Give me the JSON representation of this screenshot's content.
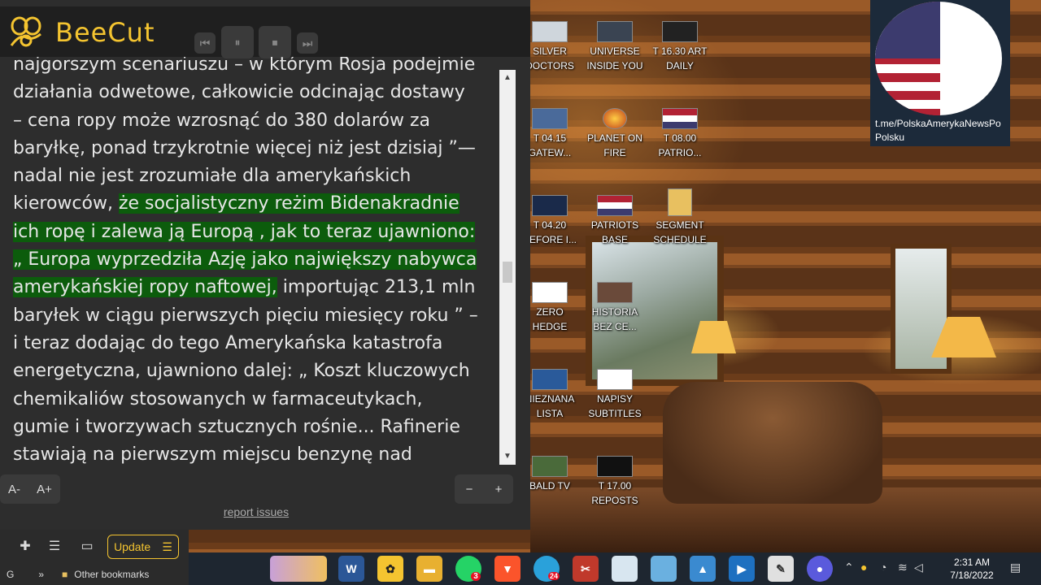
{
  "reader": {
    "app_name": "BeeCut",
    "controls": {
      "prev": "⏮",
      "pause": "⏸",
      "stop": "⏹",
      "next": "⏭"
    },
    "text": {
      "line0": "najgorszym scenariuszu – w którym Rosja podejmie",
      "line1": "działania odwetowe, całkowicie odcinając dostawy",
      "line2": "– cena ropy może wzrosnąć do 380 dolarów za",
      "line3": "baryłkę, ponad trzykrotnie więcej niż jest dzisiaj ”—",
      "line4": "nadal nie jest zrozumiałe dla amerykańskich",
      "line5a": "kierowców, ",
      "line5b": "że socjalistyczny reżim Bidenakradnie",
      "line6": "ich ropę i zalewa ją Europą , jak to teraz ujawniono:",
      "line7": "„ Europa wyprzedziła Azję jako największy nabywca",
      "line8a": "amerykańskiej ropy naftowej,",
      "line8b": " importując 213,1 mln",
      "line9": "baryłek w ciągu pierwszych pięciu miesięcy roku ” –",
      "line10": "i teraz dodając do tego Amerykańska katastrofa",
      "line11": "energetyczna, ujawniono dalej: „ Koszt kluczowych",
      "line12": "chemikaliów stosowanych w farmaceutykach,",
      "line13": "gumie i tworzywach sztucznych rośnie... Rafinerie",
      "line14": "stawiają na pierwszym miejscu benzynę nad"
    },
    "font_minus": "A-",
    "font_plus": "A+",
    "speed_minus": "−",
    "speed_plus": "+",
    "report_link": "report issues"
  },
  "desktop": {
    "icons": [
      {
        "line1": "SILVER",
        "line2": "DOCTORS"
      },
      {
        "line1": "UNIVERSE",
        "line2": "INSIDE YOU"
      },
      {
        "line1": "T 16.30 ART",
        "line2": "DAILY"
      },
      {
        "line1": "T 04.15",
        "line2": "GATEW..."
      },
      {
        "line1": "PLANET ON",
        "line2": "FIRE"
      },
      {
        "line1": "T 08.00",
        "line2": "PATRIO..."
      },
      {
        "line1": "T 04.20",
        "line2": "BEFORE I..."
      },
      {
        "line1": "PATRIOTS",
        "line2": "BASE"
      },
      {
        "line1": "SEGMENT",
        "line2": "SCHEDULE"
      },
      {
        "line1": "ZERO",
        "line2": "HEDGE"
      },
      {
        "line1": "HISTORIA",
        "line2": "BEZ CE..."
      },
      {
        "line1": "NIEZNANA",
        "line2": "LISTA"
      },
      {
        "line1": "NAPISY",
        "line2": "SUBTITLES"
      },
      {
        "line1": "BALD TV",
        "line2": ""
      },
      {
        "line1": "T 17.00",
        "line2": "REPOSTS"
      }
    ],
    "channel_badge": {
      "line1": "t.me/PolskaAmerykaNewsPo",
      "line2": "Polsku"
    }
  },
  "browser": {
    "update_label": "Update",
    "bookmarks": {
      "g": "G",
      "more": "»",
      "other": "Other bookmarks"
    }
  },
  "taskbar": {
    "time": "2:31 AM",
    "date": "7/18/2022",
    "whatsapp_badge": "3",
    "telegram_badge": "24",
    "word_label": "W"
  }
}
